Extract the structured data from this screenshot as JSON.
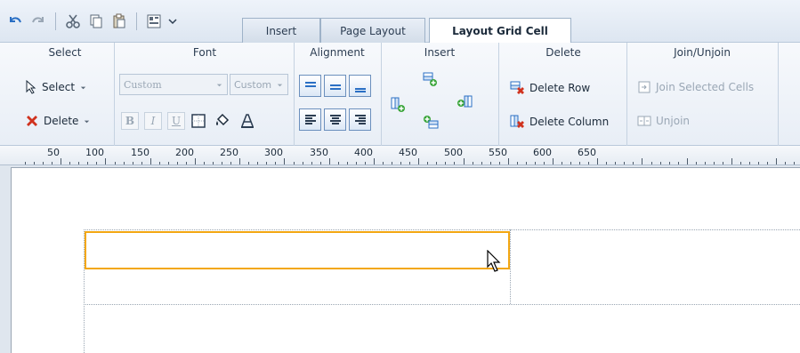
{
  "tabs": [
    {
      "label": "Insert"
    },
    {
      "label": "Page Layout"
    },
    {
      "label": "Layout Grid Cell",
      "active": true
    }
  ],
  "groups": {
    "select": {
      "label": "Select",
      "select_btn": "Select",
      "delete_btn": "Delete"
    },
    "font": {
      "label": "Font",
      "font_name": "Custom",
      "font_size": "Custom",
      "bold": "B",
      "italic": "I",
      "underline": "U"
    },
    "alignment": {
      "label": "Alignment"
    },
    "insert": {
      "label": "Insert"
    },
    "delete": {
      "label": "Delete",
      "delete_row": "Delete Row",
      "delete_column": "Delete Column"
    },
    "join": {
      "label": "Join/Unjoin",
      "join_cells": "Join Selected Cells",
      "unjoin": "Unjoin"
    }
  },
  "ruler": {
    "labels": [
      "50",
      "100",
      "150",
      "200",
      "250",
      "300",
      "350",
      "400",
      "450",
      "500",
      "550",
      "600",
      "650"
    ]
  },
  "colors": {
    "accent": "#f3a712",
    "delete_red": "#d0321e",
    "insert_green": "#3aa53a"
  }
}
